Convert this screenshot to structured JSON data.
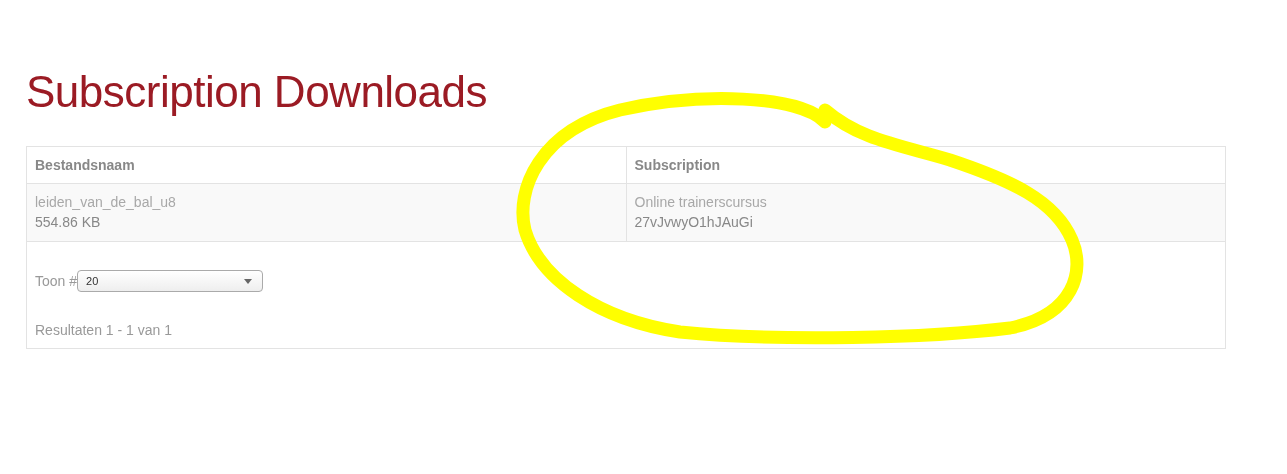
{
  "page": {
    "title": "Subscription Downloads"
  },
  "table": {
    "columns": [
      "Bestandsnaam",
      "Subscription"
    ],
    "rows": [
      {
        "cells": [
          {
            "title": "leiden_van_de_bal_u8",
            "detail": "554.86 KB"
          },
          {
            "title": "Online trainerscursus",
            "detail": "27vJvwyO1hJAuGi"
          }
        ]
      }
    ]
  },
  "pager": {
    "label": "Toon #",
    "page_size": "20",
    "results": "Resultaten 1 - 1 van 1"
  }
}
